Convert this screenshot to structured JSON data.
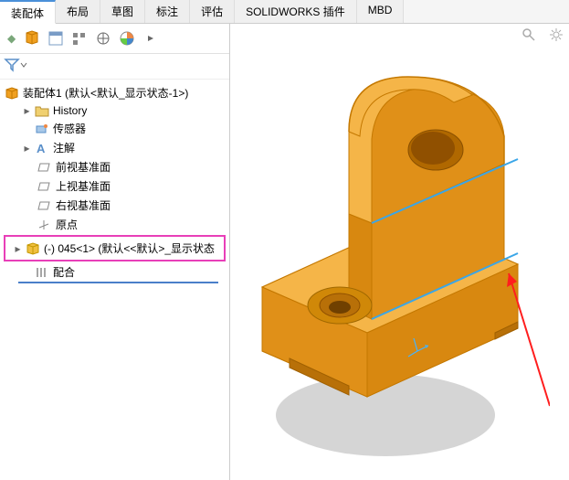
{
  "tabs": [
    {
      "label": "装配体",
      "active": true
    },
    {
      "label": "布局"
    },
    {
      "label": "草图"
    },
    {
      "label": "标注"
    },
    {
      "label": "评估"
    },
    {
      "label": "SOLIDWORKS 插件",
      "sw": true
    },
    {
      "label": "MBD",
      "sw": true
    }
  ],
  "tree": {
    "root": {
      "label": "装配体1 (默认<默认_显示状态-1>)"
    },
    "history": {
      "label": "History"
    },
    "sensors": {
      "label": "传感器"
    },
    "annotations": {
      "label": "注解"
    },
    "front_plane": {
      "label": "前视基准面"
    },
    "top_plane": {
      "label": "上视基准面"
    },
    "right_plane": {
      "label": "右视基准面"
    },
    "origin": {
      "label": "原点"
    },
    "part": {
      "label": "(-) 045<1> (默认<<默认>_显示状态"
    },
    "mates": {
      "label": "配合"
    }
  },
  "colors": {
    "part_fill": "#f0a020",
    "part_stroke": "#c47800",
    "highlight_magenta": "#e83fb8",
    "edge_blue": "#3aa6e8"
  }
}
